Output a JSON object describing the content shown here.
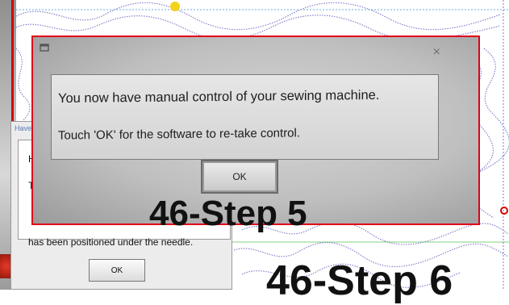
{
  "front_dialog": {
    "message_line1": "You now have manual control of your sewing machine.",
    "message_line2": "Touch 'OK' for the software to re-take control.",
    "ok_label": "OK",
    "close_glyph": "×"
  },
  "back_dialog": {
    "title_fragment": "Have",
    "fragment1": "H",
    "fragment2": "To",
    "position_line": "has been positioned under the needle.",
    "ok_label": "OK"
  },
  "caption": "46-Step 5",
  "caption2": "46-Step 6",
  "colors": {
    "frame_border": "#e0001a",
    "stitch_line": "#7b78c8",
    "marker": "#f2d21a"
  },
  "icons": [
    "app-icon",
    "close-icon"
  ]
}
